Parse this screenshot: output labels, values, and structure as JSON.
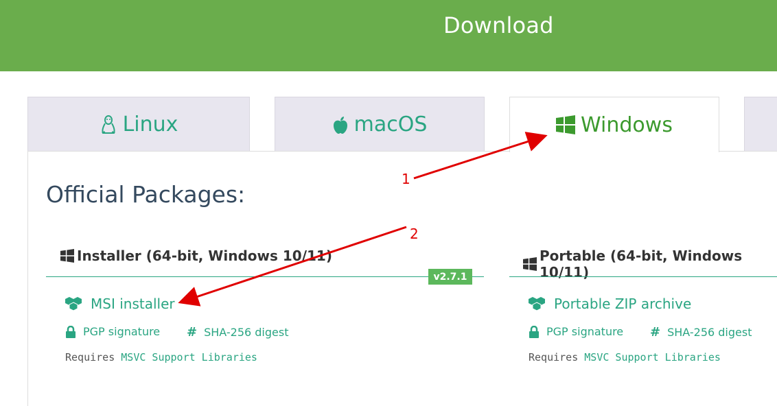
{
  "header": {
    "title": "Download"
  },
  "tabs": [
    {
      "label": "Linux",
      "icon": "linux-icon"
    },
    {
      "label": "macOS",
      "icon": "apple-icon"
    },
    {
      "label": "Windows",
      "icon": "windows-icon",
      "active": true
    }
  ],
  "main": {
    "heading": "Official Packages:",
    "packages": [
      {
        "title": "Installer (64-bit, Windows 10/11)",
        "version": "v2.7.1",
        "link": "MSI installer",
        "pgp": "PGP signature",
        "sha": "SHA-256 digest",
        "requires": "Requires",
        "requires_link": "MSVC Support Libraries"
      },
      {
        "title": "Portable (64-bit, Windows 10/11)",
        "link": "Portable ZIP archive",
        "pgp": "PGP signature",
        "sha": "SHA-256 digest",
        "requires": "Requires",
        "requires_link": "MSVC Support Libraries"
      }
    ]
  },
  "annotations": [
    {
      "label": "1"
    },
    {
      "label": "2"
    }
  ],
  "colors": {
    "banner": "#6aad4c",
    "accent": "#2aa582",
    "windows_tab": "#3c9a2e",
    "version_badge": "#5cb85c",
    "annotation": "#e00000"
  }
}
